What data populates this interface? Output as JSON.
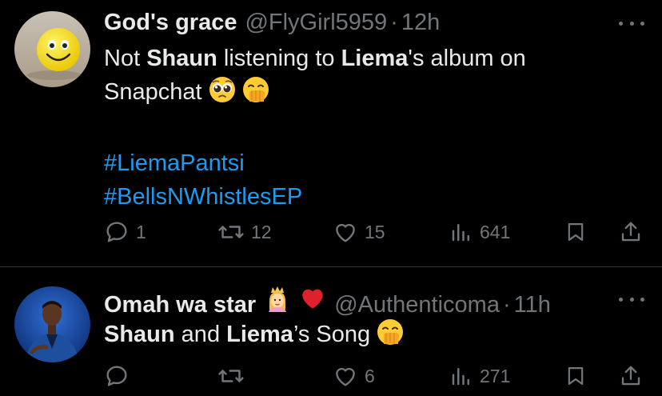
{
  "tweets": [
    {
      "name": "God's grace",
      "handle": "@FlyGirl5959",
      "separator": "·",
      "time": "12h",
      "text": {
        "w1": "Not ",
        "b1": "Shaun",
        "w2": " listening to ",
        "b2": "Liema",
        "w3": "'s album on",
        "w4": "Snapchat"
      },
      "hashtags": [
        "#LiemaPantsi",
        "#BellsNWhistlesEP"
      ],
      "emojis": [
        "pleading-face",
        "face-with-hand-over-mouth"
      ],
      "stats": {
        "replies": "1",
        "reposts": "12",
        "likes": "15",
        "views": "641"
      }
    },
    {
      "name": "Omah wa star",
      "name_emojis": [
        "princess",
        "red-heart"
      ],
      "handle": "@Authenticoma",
      "separator": "·",
      "time": "11h",
      "text": {
        "b1": "Shaun",
        "w1": " and ",
        "b2": "Liema",
        "w2": "’s Song"
      },
      "emojis": [
        "face-with-hand-over-mouth"
      ],
      "stats": {
        "replies": "",
        "reposts": "",
        "likes": "6",
        "views": "271"
      }
    }
  ],
  "colors": {
    "background": "#000000",
    "text": "#e7e9ea",
    "secondary": "#71767b",
    "link": "#1d9bf0",
    "divider": "#2f3336"
  }
}
